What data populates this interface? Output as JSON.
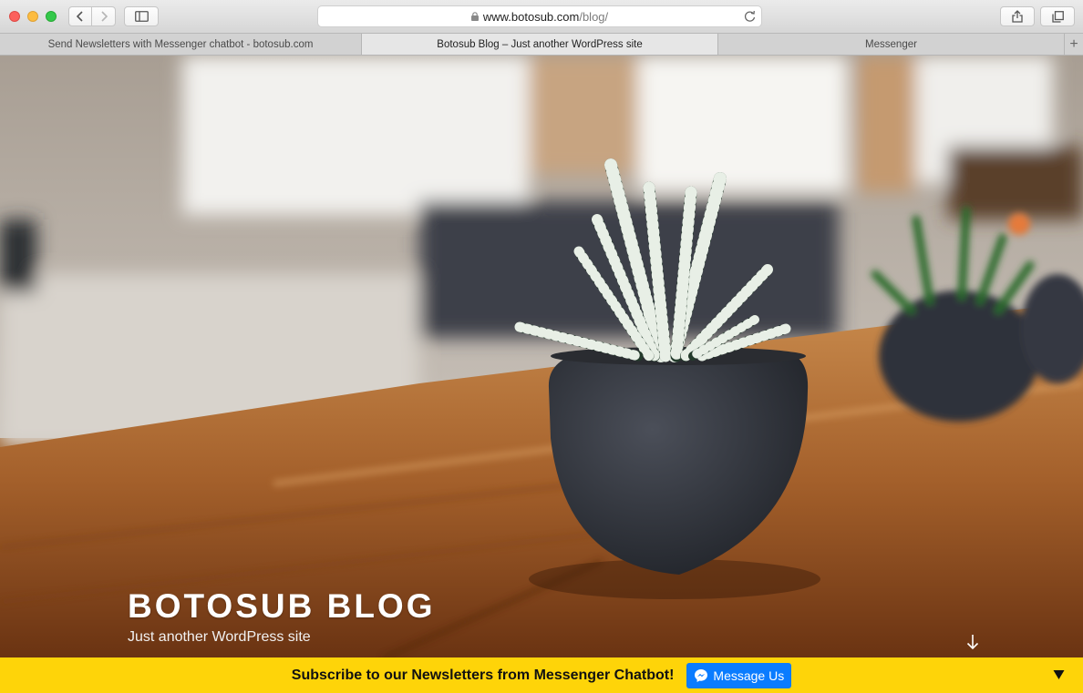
{
  "browser": {
    "url_domain": "www.botosub.com",
    "url_path": "/blog/",
    "tabs": [
      {
        "title": "Send Newsletters with Messenger chatbot - botosub.com",
        "active": false
      },
      {
        "title": "Botosub Blog – Just another WordPress site",
        "active": true
      },
      {
        "title": "Messenger",
        "active": false
      }
    ],
    "icons": {
      "back": "chevron-left-icon",
      "forward": "chevron-right-icon",
      "sidebar": "sidebar-icon",
      "lock": "lock-icon",
      "reload": "reload-icon",
      "share": "share-icon",
      "tabs": "tabs-overview-icon",
      "new_tab": "plus-icon"
    }
  },
  "hero": {
    "title": "BOTOSUB BLOG",
    "description": "Just another WordPress site",
    "scroll_icon": "arrow-down-icon"
  },
  "subscribe_bar": {
    "text": "Subscribe to our Newsletters from Messenger Chatbot!",
    "button_label": "Message Us",
    "button_icon": "messenger-icon",
    "collapse_icon": "triangle-down-icon",
    "bg_color": "#fed409",
    "button_color": "#0a7cff"
  }
}
